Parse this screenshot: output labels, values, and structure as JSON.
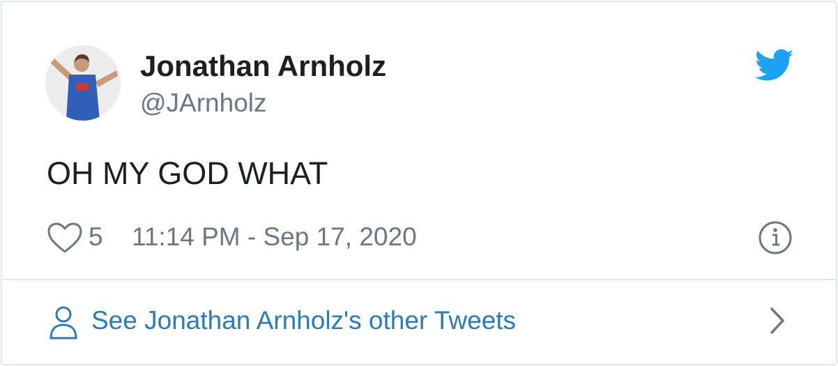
{
  "author": {
    "name": "Jonathan Arnholz",
    "handle": "@JArnholz"
  },
  "tweet": {
    "text": "OH MY GOD WHAT",
    "like_count": "5",
    "timestamp": "11:14 PM - Sep 17, 2020"
  },
  "footer": {
    "link_text": "See Jonathan Arnholz's other Tweets"
  },
  "icons": {
    "brand": "twitter-bird-icon",
    "like": "heart-icon",
    "info": "info-icon",
    "profile": "person-icon",
    "navigate": "chevron-right-icon"
  },
  "colors": {
    "name_text": "#1c2022",
    "secondary_text": "#697882",
    "link_blue": "#2b7bb9",
    "twitter_blue": "#1da1f2",
    "border": "#e1e8ed"
  }
}
